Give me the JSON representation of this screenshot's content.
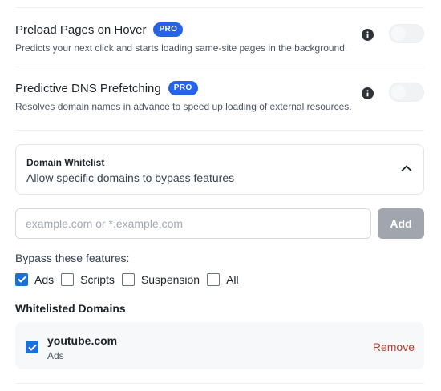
{
  "settings": [
    {
      "title": "Preload Pages on Hover",
      "badge": "PRO",
      "description": "Predicts your next click and starts loading same-site pages in the background.",
      "icon": "info-icon",
      "enabled": false
    },
    {
      "title": "Predictive DNS Prefetching",
      "badge": "PRO",
      "description": "Resolves domain names in advance to speed up loading of external resources.",
      "icon": "info-icon",
      "enabled": false
    }
  ],
  "whitelist": {
    "title": "Domain Whitelist",
    "subtitle": "Allow specific domains to bypass features",
    "expanded": true,
    "input": {
      "value": "",
      "placeholder": "example.com or *.example.com"
    },
    "add_label": "Add",
    "bypass_label": "Bypass these features:",
    "features": [
      {
        "label": "Ads",
        "checked": true
      },
      {
        "label": "Scripts",
        "checked": false
      },
      {
        "label": "Suspension",
        "checked": false
      },
      {
        "label": "All",
        "checked": false
      }
    ],
    "list_title": "Whitelisted Domains",
    "domains": [
      {
        "domain": "youtube.com",
        "features": "Ads",
        "checked": true,
        "remove_label": "Remove"
      }
    ]
  },
  "colors": {
    "accent": "#2563eb",
    "checkbox": "#1d6fd8",
    "remove": "#c0392b",
    "add_button_disabled": "#a1a6ae"
  }
}
